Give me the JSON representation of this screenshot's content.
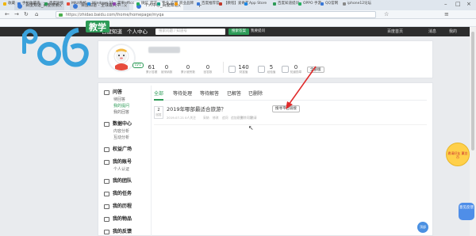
{
  "browser": {
    "tabs": [
      {
        "label": "百度知道_百度搜索"
      },
      {
        "label": "百度知道 - 全球最大中..."
      },
      {
        "label": "个人中心_百度知道"
      }
    ],
    "url": "https://zhidao.baidu.com/ihome/homepage/myqa",
    "bookmarks": [
      "收藏",
      "手机收藏夹",
      "百度链接",
      "MIUI系统",
      "Windows 11",
      "苹果efficc",
      "微信_官方",
      "专业_应用",
      "商业品牌",
      "百度推荐官",
      "【教程】爱奇艺",
      "App Store",
      "百度知道提问",
      "OPPO 手游",
      "QQ官网",
      "iphone12论坛"
    ]
  },
  "header": {
    "logo_text": "pc6",
    "logo_badge": "教学",
    "site_nav": [
      "百度知道",
      "个人中心"
    ],
    "search_placeholder": "搜索问题 / 知道号",
    "search_button": "搜索答案",
    "ask_button": "我要提问",
    "right_links": [
      "百度首页",
      "消息",
      "我的"
    ]
  },
  "profile": {
    "level_badge": "LV1",
    "stats": [
      {
        "value": "61",
        "label": "累计答题"
      },
      {
        "value": "0",
        "label": "被采纳数"
      },
      {
        "value": "0",
        "label": "累计被赞数"
      },
      {
        "value": "0",
        "label": "回答数"
      }
    ],
    "icon_stats": [
      {
        "value": "140",
        "label": "财富值"
      },
      {
        "value": "5",
        "label": "经验值"
      },
      {
        "value": "0",
        "label": "知道勋章"
      }
    ],
    "fullpage_button": "全部版"
  },
  "sidebar": {
    "sections": [
      {
        "title": "问答",
        "items": [
          "待回答",
          "我的提问",
          "我的回答"
        ]
      },
      {
        "title": "数据中心",
        "items": [
          "内容分析",
          "互动分析"
        ]
      },
      {
        "title": "权益广场",
        "items": []
      },
      {
        "title": "我的账号",
        "items": [
          "个人认证"
        ]
      },
      {
        "title": "我的团队",
        "items": []
      },
      {
        "title": "我的任务",
        "items": []
      },
      {
        "title": "我的历程",
        "items": []
      },
      {
        "title": "我的物品",
        "items": []
      },
      {
        "title": "我的反馈",
        "items": []
      }
    ],
    "active_item": "我的提问"
  },
  "tabs": [
    "全部",
    "等待处理",
    "等待解答",
    "已解答",
    "已删除"
  ],
  "active_tab": "全部",
  "question": {
    "answers": "2",
    "answers_label": "回答",
    "title": "2019年哪部最适合旅游？",
    "meta": [
      "2019-07-21",
      "0人关注",
      "采纳",
      "修改",
      "追问",
      "追加悬赏",
      "删除问题",
      "邀请"
    ],
    "tomorrow_button": "搜寻平台链接"
  },
  "widgets": {
    "mascot": "邀请好友 赢金币",
    "help": "意见反馈",
    "circle": "顶部"
  }
}
